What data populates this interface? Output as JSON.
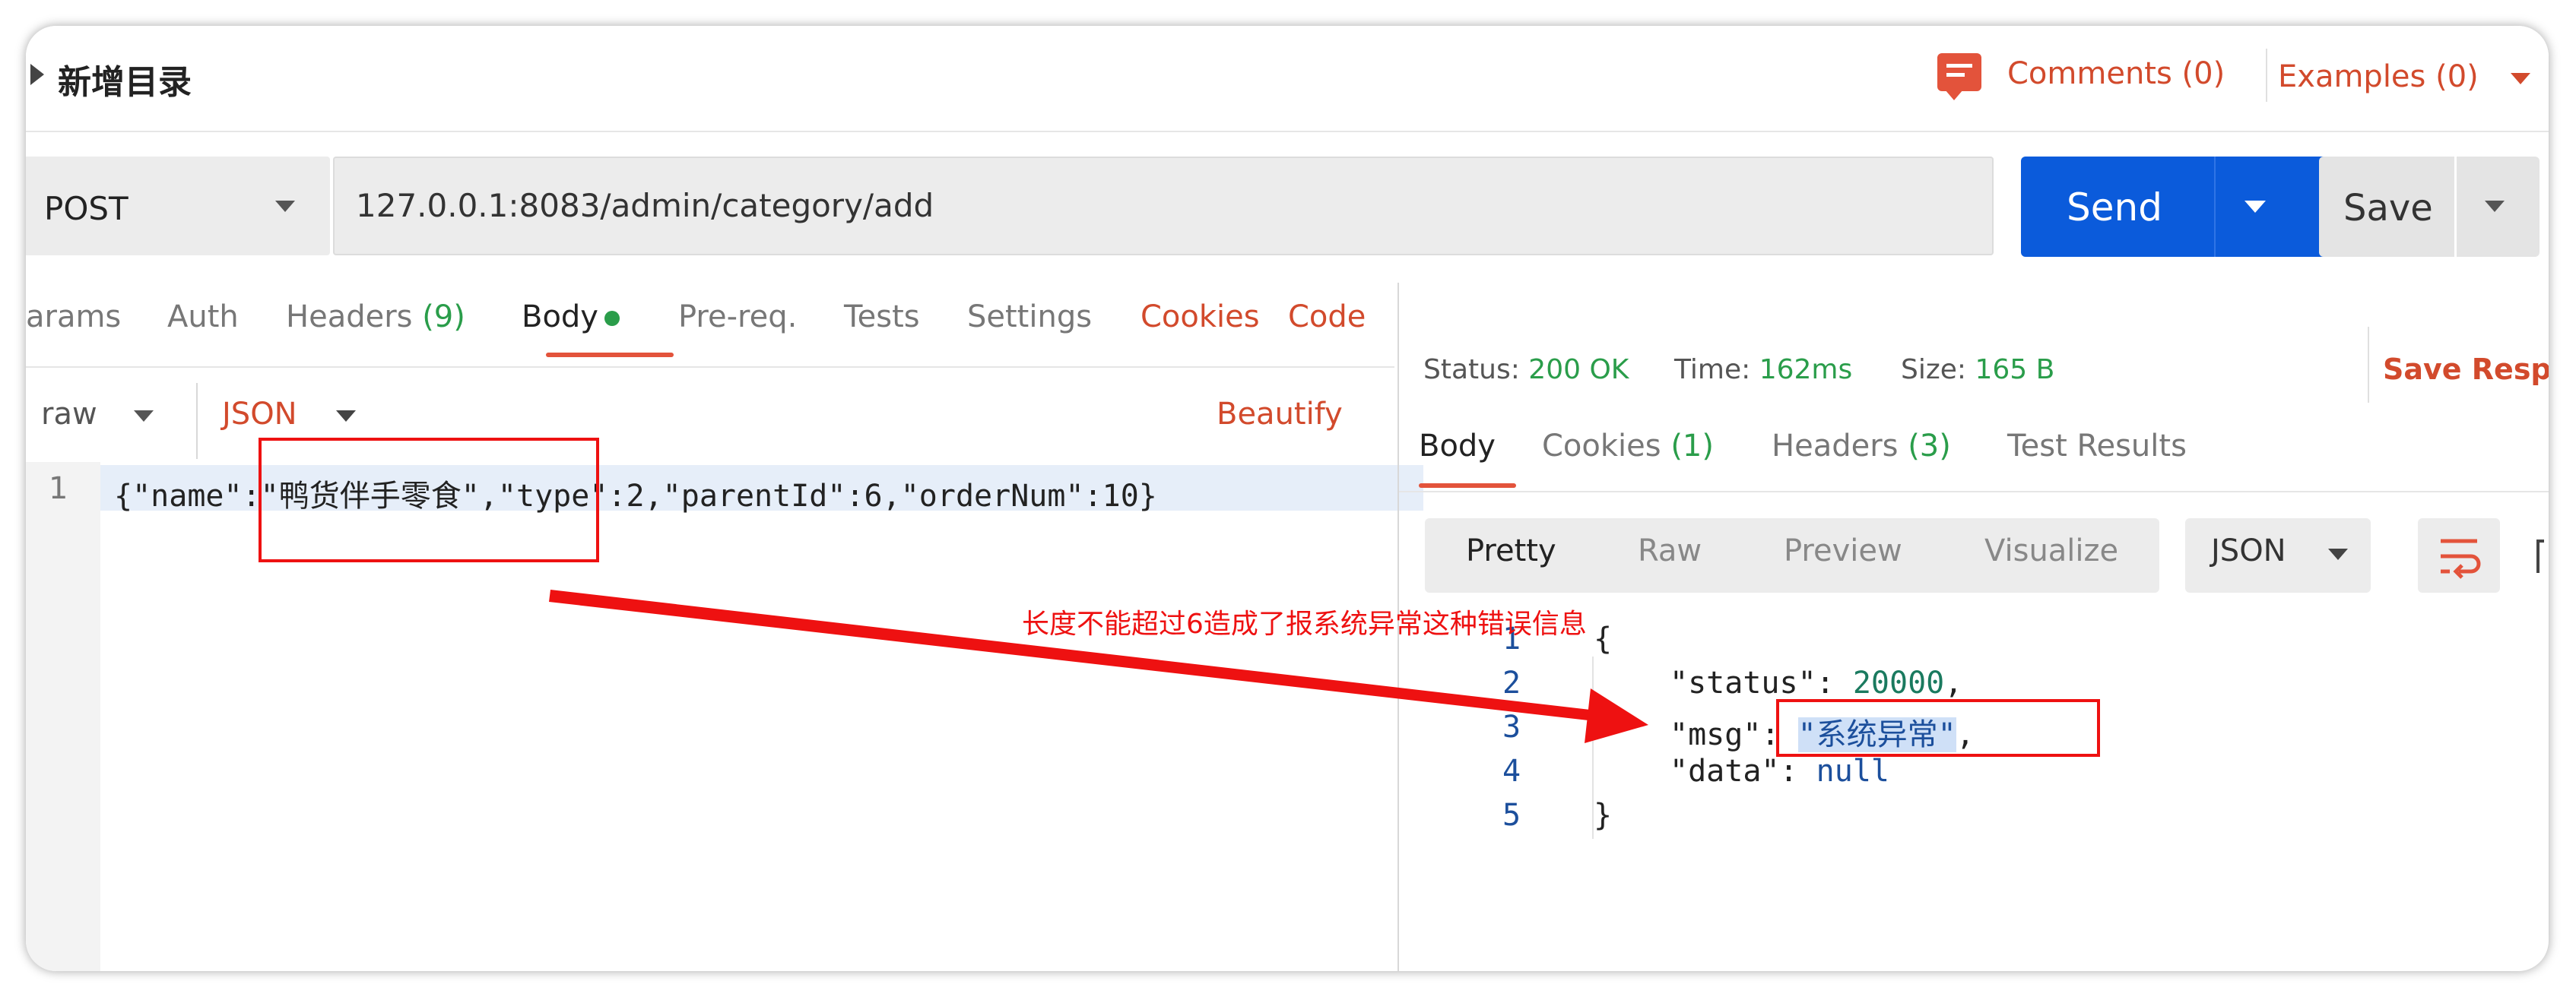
{
  "header": {
    "request_title": "新增目录",
    "comments_label": "Comments (0)",
    "examples_label": "Examples (0)"
  },
  "request": {
    "method": "POST",
    "url": "127.0.0.1:8083/admin/category/add",
    "send_label": "Send",
    "save_label": "Save"
  },
  "request_tabs": {
    "items": [
      {
        "label": "arams"
      },
      {
        "label": "Auth"
      },
      {
        "label": "Headers",
        "count": "(9)"
      },
      {
        "label": "Body"
      },
      {
        "label": "Pre-req."
      },
      {
        "label": "Tests"
      },
      {
        "label": "Settings"
      }
    ],
    "cookies_label": "Cookies",
    "code_label": "Code"
  },
  "body_options": {
    "mode": "raw",
    "format": "JSON",
    "beautify_label": "Beautify"
  },
  "editor": {
    "line_number": "1",
    "part1": "{\"name\":",
    "part2": "\"鸭货伴手零食\"",
    "part3": ",\"type\":2,\"parentId\":6,\"orderNum\":10}"
  },
  "response": {
    "status_label": "Status:",
    "status_value": "200 OK",
    "time_label": "Time:",
    "time_value": "162ms",
    "size_label": "Size:",
    "size_value": "165 B",
    "save_response_label": "Save Respo",
    "tabs": {
      "body": "Body",
      "cookies": "Cookies",
      "cookies_count": "(1)",
      "headers": "Headers",
      "headers_count": "(3)",
      "test_results": "Test Results"
    },
    "view_modes": [
      "Pretty",
      "Raw",
      "Preview",
      "Visualize"
    ],
    "format": "JSON",
    "lines": {
      "n1": "1",
      "n2": "2",
      "n3": "3",
      "n4": "4",
      "n5": "5",
      "open_brace": "{",
      "status_key": "\"status\"",
      "status_val": "20000",
      "msg_key": "\"msg\"",
      "msg_val": "\"系统异常\"",
      "data_key": "\"data\"",
      "data_val": "null",
      "close_brace": "}"
    }
  },
  "annotation": {
    "text": "长度不能超过6造成了报系统异常这种错误信息",
    "color": "#ee1111"
  },
  "colors": {
    "accent": "#e3533b",
    "send_blue": "#0b5bdb",
    "success_green": "#2a9d4a"
  }
}
